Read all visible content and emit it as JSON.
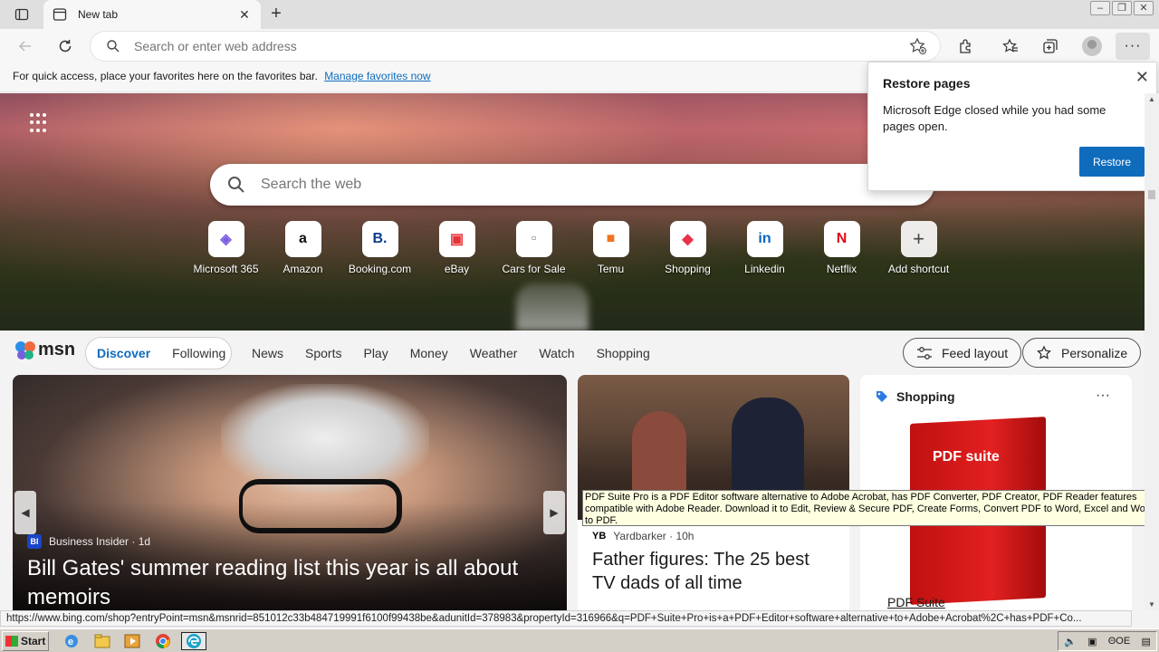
{
  "browser": {
    "tab": {
      "title": "New tab"
    },
    "address_placeholder": "Search or enter web address",
    "favorites_bar": {
      "text": "For quick access, place your favorites here on the favorites bar.",
      "link": "Manage favorites now"
    }
  },
  "newtab": {
    "search_placeholder": "Search the web",
    "shortcuts": [
      {
        "label": "Microsoft 365",
        "icon": "microsoft-365-icon",
        "glyph": "◈",
        "color": "#7a5ce0"
      },
      {
        "label": "Amazon",
        "icon": "amazon-icon",
        "glyph": "a",
        "color": "#111111"
      },
      {
        "label": "Booking.com",
        "icon": "booking-icon",
        "glyph": "B.",
        "color": "#0a3d8f"
      },
      {
        "label": "eBay",
        "icon": "ebay-icon",
        "glyph": "▣",
        "color": "#e53238"
      },
      {
        "label": "Cars for Sale",
        "icon": "cars-for-sale-icon",
        "glyph": "▫",
        "color": "#888888"
      },
      {
        "label": "Temu",
        "icon": "temu-icon",
        "glyph": "■",
        "color": "#f07420"
      },
      {
        "label": "Shopping",
        "icon": "shopping-bag-icon",
        "glyph": "◆",
        "color": "#e8334a"
      },
      {
        "label": "Linkedin",
        "icon": "linkedin-icon",
        "glyph": "in",
        "color": "#0a66c2"
      },
      {
        "label": "Netflix",
        "icon": "netflix-icon",
        "glyph": "N",
        "color": "#e50914"
      },
      {
        "label": "Add shortcut",
        "icon": "plus-icon",
        "glyph": "+",
        "color": "#444444"
      }
    ]
  },
  "msn": {
    "logo_text": "msn",
    "pill": {
      "discover": "Discover",
      "following": "Following"
    },
    "nav": [
      "News",
      "Sports",
      "Play",
      "Money",
      "Weather",
      "Watch",
      "Shopping"
    ],
    "feed_layout": "Feed layout",
    "personalize": "Personalize"
  },
  "cards": {
    "big": {
      "source_badge": "BI",
      "source": "Business Insider",
      "age": "· 1d",
      "headline": "Bill Gates' summer reading list this year is all about memoirs"
    },
    "mid": {
      "source_badge": "YB",
      "source": "Yardbarker",
      "age": "· 10h",
      "headline": "Father figures: The 25 best TV dads of all time"
    },
    "shop": {
      "header": "Shopping",
      "more": "···",
      "box_label": "PDF suite",
      "title": "PDF Suite"
    }
  },
  "tooltip": "PDF Suite Pro is a PDF Editor software alternative to Adobe Acrobat, has PDF Converter, PDF Creator, PDF Reader features compatible with Adobe Reader. Download it to Edit, Review & Secure PDF, Create Forms, Convert PDF to Word, Excel and Word to PDF.",
  "restore_popup": {
    "title": "Restore pages",
    "body": "Microsoft Edge closed while you had some pages open.",
    "button": "Restore"
  },
  "status_url": "https://www.bing.com/shop?entryPoint=msn&msnrid=851012c33b484719991f6100f99438be&adunitId=378983&propertyId=316966&q=PDF+Suite+Pro+is+a+PDF+Editor+software+alternative+to+Adobe+Acrobat%2C+has+PDF+Co...",
  "taskbar": {
    "start": "Start",
    "tray_text": "ΘΟΕ"
  },
  "colors": {
    "accent": "#0f6cbd"
  }
}
